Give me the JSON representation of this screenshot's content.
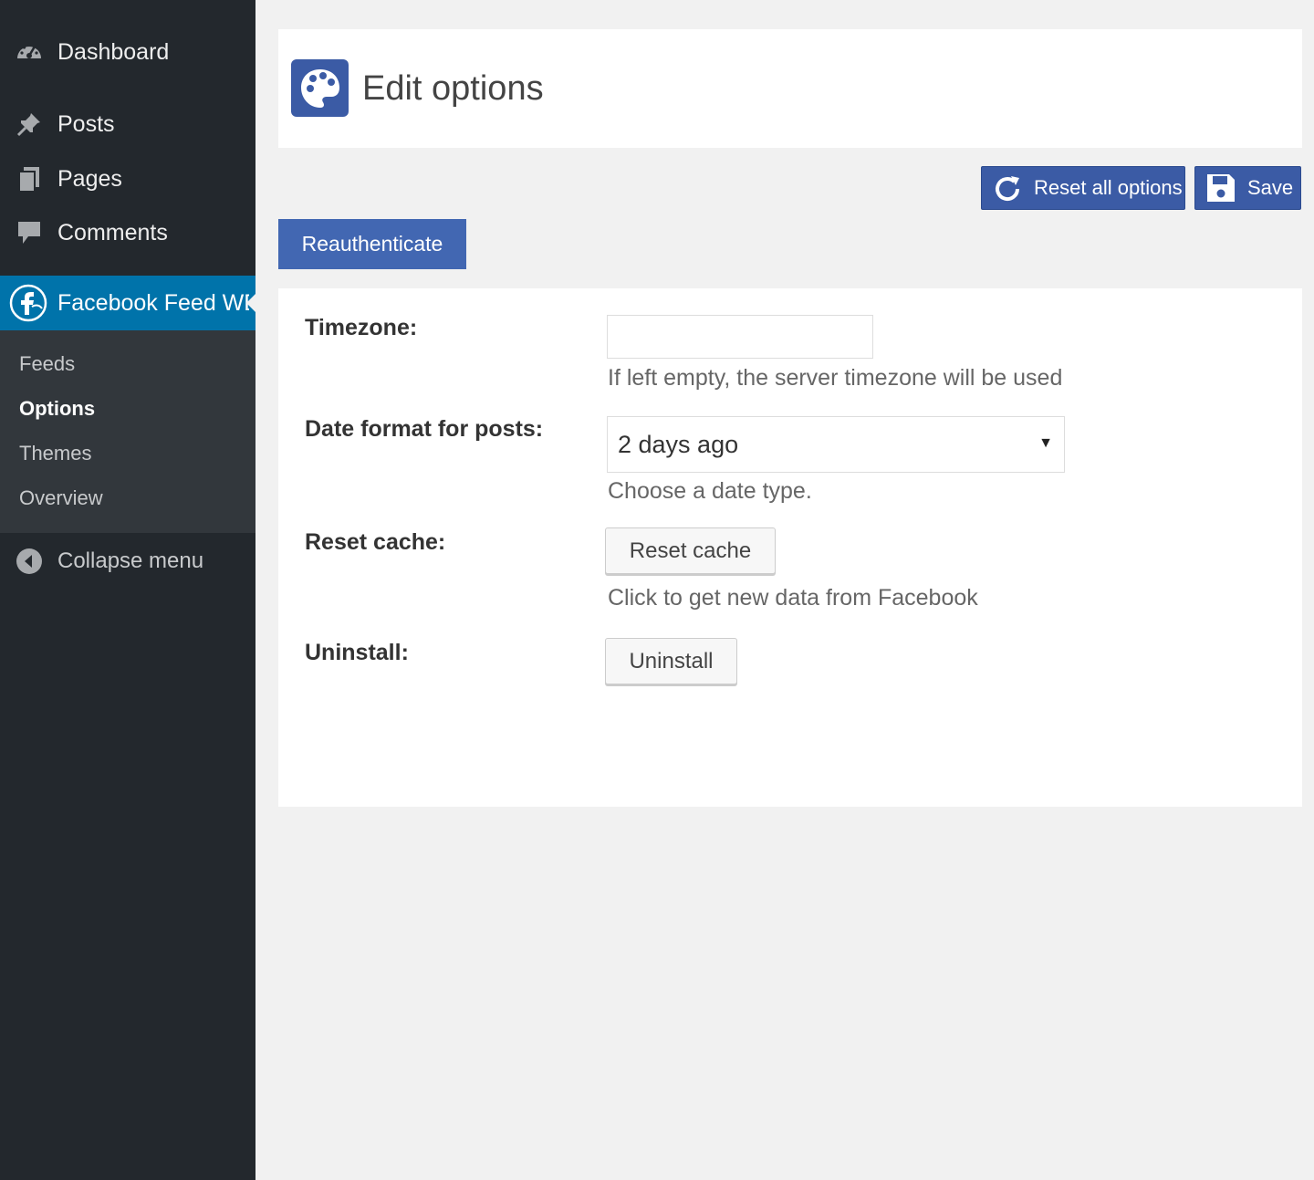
{
  "sidebar": {
    "menu": {
      "dashboard": "Dashboard",
      "posts": "Posts",
      "pages": "Pages",
      "comments": "Comments",
      "plugin": "Facebook Feed WD",
      "collapse": "Collapse menu"
    },
    "submenu": {
      "feeds": "Feeds",
      "options": "Options",
      "themes": "Themes",
      "overview": "Overview"
    },
    "current_submenu": "Options"
  },
  "header": {
    "title": "Edit options",
    "icon": "palette-icon"
  },
  "toolbar": {
    "reset_all_label": "Reset all options",
    "save_label": "Save",
    "reauthenticate_label": "Reauthenticate"
  },
  "options": {
    "timezone": {
      "label": "Timezone:",
      "value": "",
      "description": "If left empty, the server timezone will be used"
    },
    "date_format": {
      "label": "Date format for posts:",
      "selected": "2 days ago",
      "description": "Choose a date type."
    },
    "reset_cache": {
      "label": "Reset cache:",
      "button": "Reset cache",
      "description": "Click to get new data from Facebook"
    },
    "uninstall": {
      "label": "Uninstall:",
      "button": "Uninstall"
    }
  },
  "colors": {
    "sidebar_bg": "#23282d",
    "submenu_bg": "#32373c",
    "active_menu_bg": "#0073aa",
    "brand_blue": "#3b5ba5",
    "reauth_blue": "#4267b2",
    "page_bg": "#f1f1f1"
  }
}
